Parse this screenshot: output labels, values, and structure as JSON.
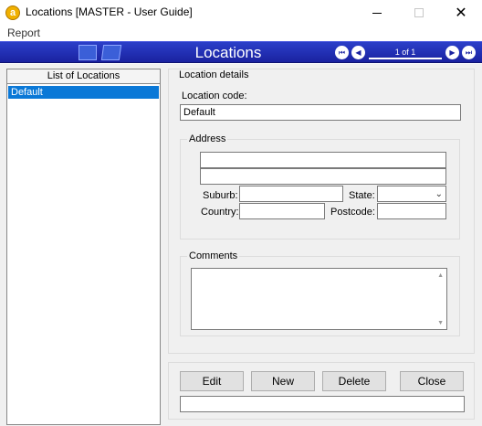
{
  "window": {
    "title": "Locations [MASTER - User Guide]",
    "app_icon_glyph": "a",
    "minimize_icon": "minimize-icon",
    "maximize_icon": "maximize-icon",
    "close_icon": "close-icon"
  },
  "menu": {
    "items": [
      "Report"
    ]
  },
  "header": {
    "title": "Locations",
    "page_indicator": "1 of 1",
    "accent_color": "#1f2db5"
  },
  "list": {
    "header": "List of Locations",
    "items": [
      {
        "label": "Default",
        "selected": true
      }
    ]
  },
  "details": {
    "group_label": "Location details",
    "location_code_label": "Location code:",
    "location_code_value": "Default",
    "address": {
      "group_label": "Address",
      "line1": "",
      "line2": "",
      "suburb_label": "Suburb:",
      "suburb_value": "",
      "state_label": "State:",
      "state_value": "",
      "country_label": "Country:",
      "country_value": "",
      "postcode_label": "Postcode:",
      "postcode_value": ""
    },
    "comments": {
      "group_label": "Comments",
      "value": ""
    }
  },
  "buttons": {
    "edit": "Edit",
    "new": "New",
    "delete": "Delete",
    "close": "Close"
  },
  "status": ""
}
